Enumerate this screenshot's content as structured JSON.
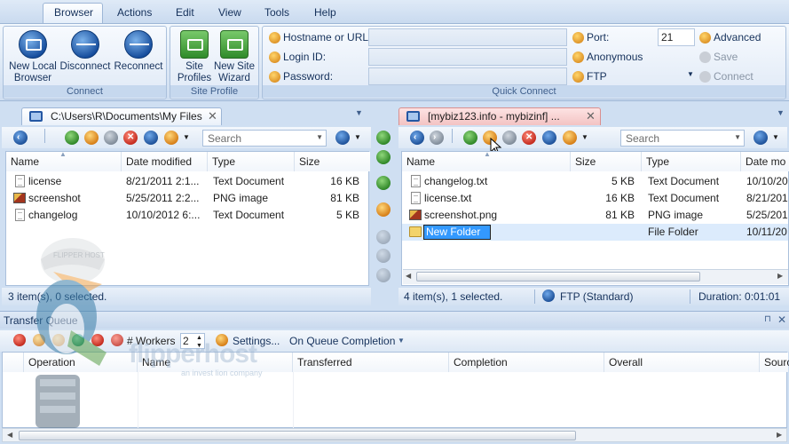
{
  "menu": [
    "Browser",
    "Actions",
    "Edit",
    "View",
    "Tools",
    "Help"
  ],
  "ribbon": {
    "connect_group": {
      "label": "Connect",
      "buttons": [
        "New Local Browser",
        "Disconnect",
        "Reconnect"
      ]
    },
    "site_profile_group": {
      "label": "Site Profile",
      "buttons": [
        "Site Profiles",
        "New Site Wizard"
      ]
    },
    "quick_connect": {
      "label": "Quick Connect",
      "hostname_label": "Hostname or URL:",
      "login_label": "Login ID:",
      "password_label": "Password:",
      "port_label": "Port:",
      "port_value": "21",
      "anonymous_label": "Anonymous",
      "protocol_label": "FTP",
      "advanced_label": "Advanced",
      "save_label": "Save",
      "connect_label": "Connect"
    }
  },
  "local_pane": {
    "tab_title": "C:\\Users\\R\\Documents\\My Files",
    "search_placeholder": "Search",
    "columns": [
      "Name",
      "Date modified",
      "Type",
      "Size"
    ],
    "rows": [
      {
        "name": "license",
        "date": "8/21/2011 2:1...",
        "type": "Text Document",
        "size": "16 KB",
        "icon": "text-doc-icon"
      },
      {
        "name": "screenshot",
        "date": "5/25/2011 2:2...",
        "type": "PNG image",
        "size": "81 KB",
        "icon": "png-image-icon"
      },
      {
        "name": "changelog",
        "date": "10/10/2012 6:...",
        "type": "Text Document",
        "size": "5 KB",
        "icon": "text-doc-icon"
      }
    ],
    "status": "3 item(s), 0 selected."
  },
  "remote_pane": {
    "tab_title": "[mybiz123.info - mybizinf] ...",
    "search_placeholder": "Search",
    "columns": [
      "Name",
      "Size",
      "Type",
      "Date mo"
    ],
    "rows": [
      {
        "name": "changelog.txt",
        "size": "5 KB",
        "type": "Text Document",
        "date": "10/10/20",
        "icon": "text-doc-icon"
      },
      {
        "name": "license.txt",
        "size": "16 KB",
        "type": "Text Document",
        "date": "8/21/201",
        "icon": "text-doc-icon"
      },
      {
        "name": "screenshot.png",
        "size": "81 KB",
        "type": "PNG image",
        "date": "5/25/201",
        "icon": "png-image-icon"
      },
      {
        "name": "New Folder",
        "size": "",
        "type": "File Folder",
        "date": "10/11/20",
        "icon": "folder-icon"
      }
    ],
    "status": "4 item(s), 1 selected.",
    "protocol": "FTP (Standard)",
    "duration": "Duration: 0:01:01"
  },
  "transfer_queue": {
    "title": "Transfer Queue",
    "workers_label": "# Workers",
    "workers_value": "2",
    "settings_label": "Settings...",
    "on_queue_label": "On Queue Completion",
    "columns": [
      "Operation",
      "Name",
      "Transferred",
      "Completion",
      "Overall",
      "Sourc"
    ]
  },
  "watermark": {
    "mascot_text": "FLIPPER HOST",
    "brand": "flipperhost",
    "tagline": "an invest lion company"
  },
  "colors": {
    "ribbon_bg": "#dbe7f5",
    "remote_tab_accent": "#f4c6c6",
    "selection": "#3399ff",
    "text": "#15315b"
  }
}
